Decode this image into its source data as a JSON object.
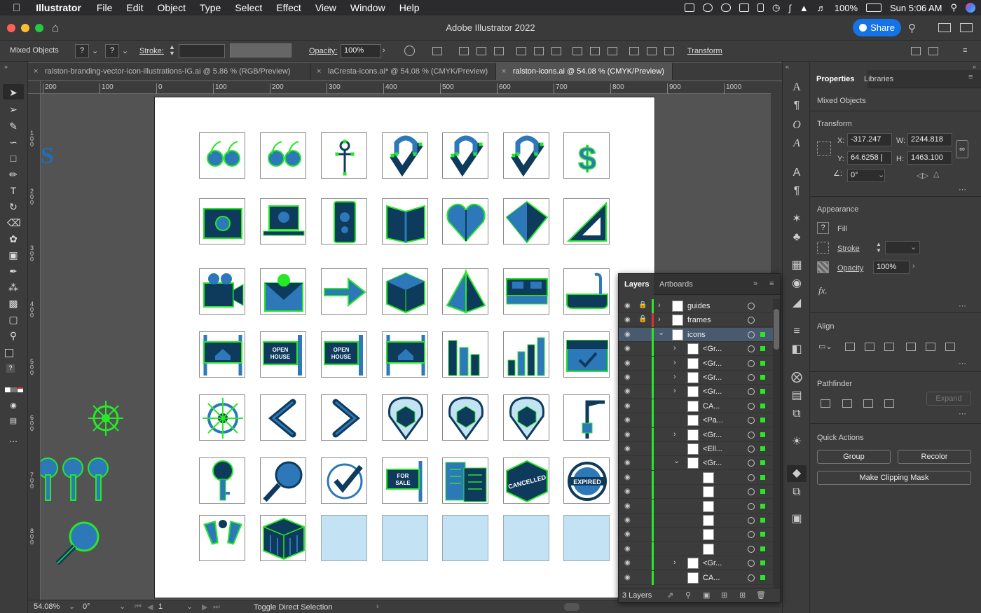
{
  "menubar": {
    "items": [
      "Illustrator",
      "File",
      "Edit",
      "Object",
      "Type",
      "Select",
      "Effect",
      "View",
      "Window",
      "Help"
    ],
    "battery": "100%",
    "clock": "Sun 5:06 AM"
  },
  "window": {
    "title": "Adobe Illustrator 2022",
    "share_label": "Share"
  },
  "control_bar": {
    "selection": "Mixed Objects",
    "fill_q": "?",
    "stroke_q": "?",
    "stroke_label": "Stroke:",
    "opacity_label": "Opacity:",
    "opacity_value": "100%",
    "transform_label": "Transform"
  },
  "tabs": [
    {
      "label": "ralston-branding-vector-icon-illustrations-IG.ai @ 5.86 % (RGB/Preview)"
    },
    {
      "label": "laCresta-icons.ai* @ 54.08 % (CMYK/Preview)"
    },
    {
      "label": "ralston-icons.ai @ 54.08 % (CMYK/Preview)"
    }
  ],
  "hruler": [
    "200",
    "100",
    "0",
    "100",
    "200",
    "300",
    "400",
    "500",
    "600",
    "700",
    "800",
    "900",
    "1000"
  ],
  "vruler": [
    "1 0 0",
    "2 0 0",
    "3 0 0",
    "4 0 0",
    "5 0 0",
    "6 0 0",
    "7 0 0",
    "8 0 0"
  ],
  "artboard_icons": [
    [
      "quote-open",
      "quote-close",
      "person",
      "hanger-check",
      "hanger-check",
      "hanger-check",
      "dollar"
    ],
    [
      "camera-box",
      "laptop",
      "phone",
      "book",
      "heart",
      "diamond",
      "ruler-triangle"
    ],
    [
      "video-camera",
      "envelope",
      "arrow-right",
      "cube",
      "pyramid",
      "bed",
      "bathtub"
    ],
    [
      "house-sign",
      "open-house-sign",
      "open-house-flag",
      "house-sign",
      "buildings",
      "bar-chart",
      "calendar-check"
    ],
    [
      "ship-wheel",
      "chevron-left",
      "chevron-right",
      "map-pin",
      "map-pin",
      "map-pin",
      "crane"
    ],
    [
      "key",
      "magnifier",
      "check-circle",
      "for-sale-sign",
      "blueprint",
      "cancelled-stamp",
      "expired-stamp"
    ],
    [
      "cheers",
      "rubik-cube",
      "empty",
      "empty",
      "empty",
      "empty",
      "empty"
    ]
  ],
  "icon_text": {
    "open_house": "OPEN HOUSE",
    "for_sale": "FOR SALE",
    "cancelled": "CANCELLED",
    "expired": "EXPIRED"
  },
  "status": {
    "zoom": "54.08%",
    "rotation": "0°",
    "artboard": "1",
    "hint": "Toggle Direct Selection"
  },
  "properties": {
    "tabs": [
      "Properties",
      "Libraries"
    ],
    "selection": "Mixed Objects",
    "transform": {
      "title": "Transform",
      "x": "-317.247",
      "y": "64.6258 |",
      "w": "2244.818",
      "h": "1463.100",
      "angle": "0°"
    },
    "appearance": {
      "title": "Appearance",
      "fill": "Fill",
      "stroke": "Stroke",
      "opacity_label": "Opacity",
      "opacity": "100%",
      "fx": "fx."
    },
    "align_title": "Align",
    "pathfinder_title": "Pathfinder",
    "expand": "Expand",
    "quick_actions": "Quick Actions",
    "group": "Group",
    "recolor": "Recolor",
    "clipping": "Make Clipping Mask"
  },
  "layers": {
    "tabs": [
      "Layers",
      "Artboards"
    ],
    "rows": [
      {
        "name": "guides",
        "indent": 0,
        "bar": "#27e827",
        "lock": true
      },
      {
        "name": "frames",
        "indent": 0,
        "bar": "#e03030",
        "lock": true
      },
      {
        "name": "icons",
        "indent": 0,
        "bar": "#27e827",
        "expanded": true,
        "sel": true
      },
      {
        "name": "<Gr...",
        "indent": 1,
        "bar": "#27e827",
        "arrow": true
      },
      {
        "name": "<Gr...",
        "indent": 1,
        "bar": "#27e827",
        "arrow": true
      },
      {
        "name": "<Gr...",
        "indent": 1,
        "bar": "#27e827",
        "arrow": true
      },
      {
        "name": "<Gr...",
        "indent": 1,
        "bar": "#27e827",
        "arrow": true
      },
      {
        "name": "CA...",
        "indent": 1,
        "bar": "#27e827"
      },
      {
        "name": "<Pa...",
        "indent": 1,
        "bar": "#27e827"
      },
      {
        "name": "<Gr...",
        "indent": 1,
        "bar": "#27e827",
        "arrow": true
      },
      {
        "name": "<Ell...",
        "indent": 1,
        "bar": "#27e827"
      },
      {
        "name": "<Gr...",
        "indent": 1,
        "bar": "#27e827",
        "expanded": true
      },
      {
        "name": "",
        "indent": 2,
        "bar": "#27e827"
      },
      {
        "name": "",
        "indent": 2,
        "bar": "#27e827"
      },
      {
        "name": "",
        "indent": 2,
        "bar": "#27e827"
      },
      {
        "name": "",
        "indent": 2,
        "bar": "#27e827"
      },
      {
        "name": "",
        "indent": 2,
        "bar": "#27e827"
      },
      {
        "name": "",
        "indent": 2,
        "bar": "#27e827"
      },
      {
        "name": "<Gr...",
        "indent": 1,
        "bar": "#27e827",
        "arrow": true
      },
      {
        "name": "CA...",
        "indent": 1,
        "bar": "#27e827"
      }
    ],
    "footer": "3 Layers"
  },
  "colors": {
    "navy": "#0e3a5c",
    "blue": "#2d78b8",
    "light": "#c3e3f5",
    "green": "#27e827",
    "accent": "#1473e6"
  }
}
